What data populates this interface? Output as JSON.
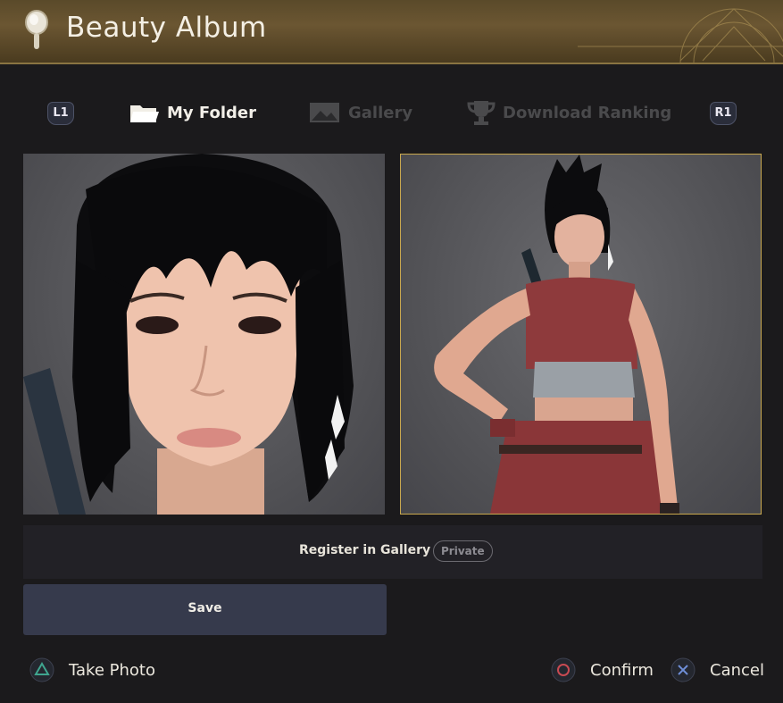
{
  "window": {
    "title": "Beauty Album"
  },
  "tabs": {
    "left_shoulder": "L1",
    "right_shoulder": "R1",
    "items": [
      {
        "label": "My Folder",
        "icon": "folder-icon",
        "active": true
      },
      {
        "label": "Gallery",
        "icon": "image-icon",
        "active": false
      },
      {
        "label": "Download Ranking",
        "icon": "trophy-icon",
        "active": false
      }
    ]
  },
  "photos": [
    {
      "name": "face-close-up",
      "selected": false
    },
    {
      "name": "full-body",
      "selected": true
    }
  ],
  "register": {
    "label": "Register in Gallery",
    "status": "Private"
  },
  "actions": {
    "save_label": "Save"
  },
  "footer": {
    "take_photo": {
      "icon": "triangle-button-icon",
      "label": "Take Photo"
    },
    "confirm": {
      "icon": "circle-button-icon",
      "label": "Confirm"
    },
    "cancel": {
      "icon": "cross-button-icon",
      "label": "Cancel"
    }
  },
  "colors": {
    "accent_gold": "#c9a84e",
    "background": "#1b1a1c",
    "save_button": "#363a4c",
    "triangle": "#3fa58f",
    "circle": "#c84a52",
    "cross": "#6f8fd8"
  }
}
